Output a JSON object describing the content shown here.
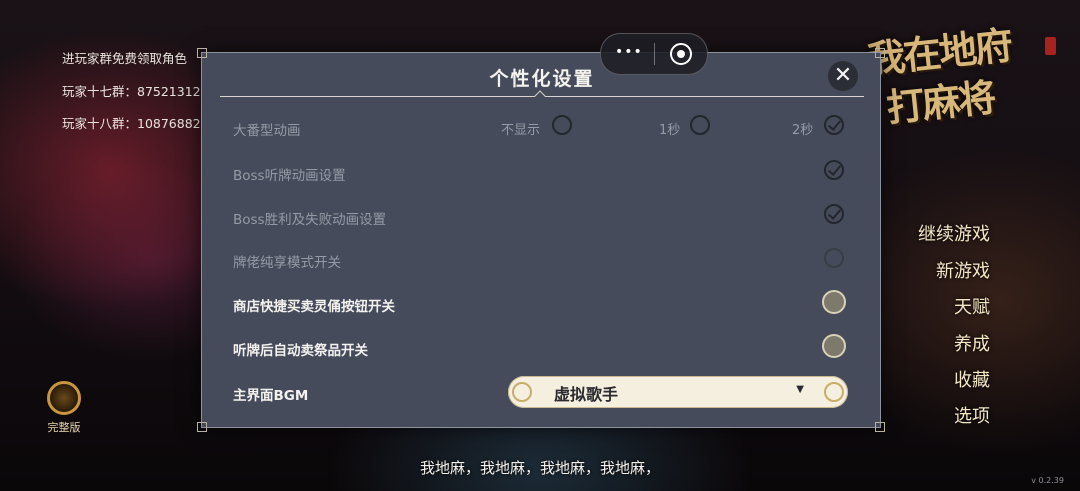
{
  "background": {
    "group_lines": [
      "进玩家群免费领取角色",
      "玩家十七群：87521312",
      "玩家十八群：10876882"
    ],
    "game_title_line1": "我在地府",
    "game_title_line2": "打麻将",
    "menu": [
      "继续游戏",
      "新游戏",
      "天赋",
      "养成",
      "收藏",
      "选项"
    ],
    "badge_label": "完整版",
    "subtitle": "我地麻，我地麻，我地麻，我地麻，",
    "version": "v 0.2.39"
  },
  "capsule": {
    "menu_icon": "more-dots-icon",
    "close_icon": "record-circle-icon"
  },
  "panel": {
    "title": "个性化设置",
    "close_icon": "close-x-icon",
    "rows": [
      {
        "label": "大番型动画",
        "enabled": false,
        "options": [
          "不显示",
          "1秒",
          "2秒"
        ],
        "selected": "2秒"
      },
      {
        "label": "Boss听牌动画设置",
        "enabled": false,
        "checked": true
      },
      {
        "label": "Boss胜利及失败动画设置",
        "enabled": false,
        "checked": true
      },
      {
        "label": "牌佬纯享模式开关",
        "enabled": false,
        "checked": false
      },
      {
        "label": "商店快捷买卖灵俑按钮开关",
        "enabled": true,
        "checked": false
      },
      {
        "label": "听牌后自动卖祭品开关",
        "enabled": true,
        "checked": false
      },
      {
        "label": "主界面BGM",
        "enabled": true,
        "value": "虚拟歌手"
      }
    ]
  },
  "colors": {
    "panel_bg": "#454b5b",
    "dim_text": "#959aa6",
    "bright_text": "#f4f2ee",
    "menu_text": "#f3e6c6",
    "dropdown_bg": "#f4efde"
  }
}
